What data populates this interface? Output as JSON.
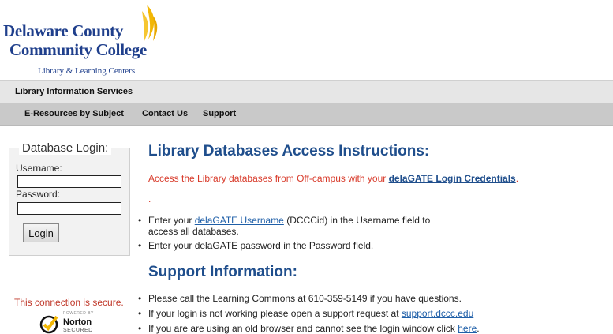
{
  "header": {
    "logo_line1": "Delaware County",
    "logo_line2": "Community College",
    "logo_line3": "Library & Learning Centers"
  },
  "bar": {
    "title": "Library Information Services"
  },
  "nav": {
    "items": [
      "E-Resources by Subject",
      "Contact Us",
      "Support"
    ]
  },
  "login": {
    "legend": "Database Login:",
    "username_label": "Username:",
    "username_value": "",
    "password_label": "Password:",
    "password_value": "",
    "button": "Login"
  },
  "secure": {
    "text": "This connection is secure.",
    "norton_powered": "POWERED BY",
    "norton_name": "Norton",
    "norton_secured": "SECURED"
  },
  "content": {
    "title": "Library Databases Access Instructions:",
    "intro_text": "Access the Library databases from Off-campus with your ",
    "intro_link": "delaGATE Login Credentials",
    "intro_end": ".",
    "dot": ".",
    "bullets1": {
      "b1_pre": "Enter your ",
      "b1_link": "delaGATE Username",
      "b1_post": " (DCCCid) in the Username field to",
      "b1_line2": "access all databases.",
      "b2": "Enter your delaGATE password in the Password field."
    },
    "support_title": "Support Information:",
    "bullets2": {
      "s1": "Please call the Learning Commons at 610-359-5149 if you have questions.",
      "s2_pre": "If your login is not working please open a support request at ",
      "s2_link": "support.dccc.edu",
      "s3_pre": "If you are are using an old browser and cannot see the login window click ",
      "s3_link": "here",
      "s3_post": "."
    }
  },
  "colors": {
    "brand_blue": "#1f3f8c",
    "heading_blue": "#1f4e8c",
    "link_blue": "#1f5fa8",
    "alert_red": "#d83a2a",
    "flame_yellow": "#f2b705"
  }
}
